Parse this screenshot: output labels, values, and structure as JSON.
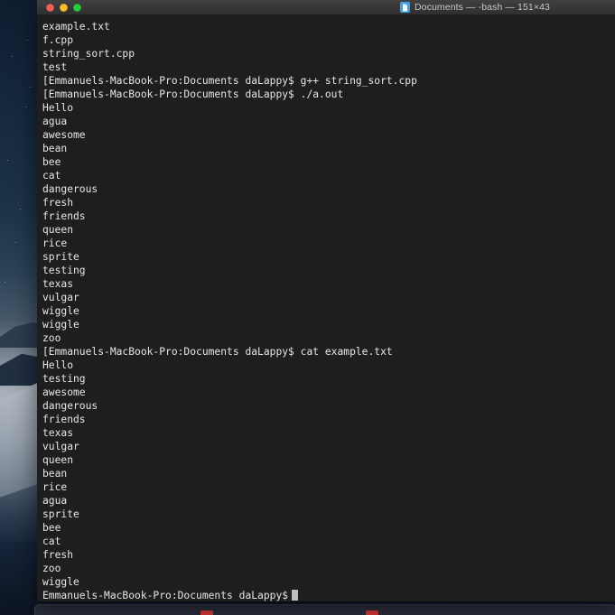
{
  "window": {
    "title": "Documents — -bash — 151×43",
    "icon": "document-icon",
    "traffic_lights": {
      "close_label": "Close",
      "minimize_label": "Minimize",
      "zoom_label": "Zoom"
    },
    "colors": {
      "terminal_background": "#1e1e1e",
      "terminal_text": "#e6e6e6",
      "titlebar": "#373737",
      "close": "#ef5f57",
      "minimize": "#f7bd2e",
      "zoom": "#2ac940",
      "doc_icon": "#3aa0e8",
      "cursor": "#bfbfbf"
    }
  },
  "terminal": {
    "prompt": "Emmanuels-MacBook-Pro:Documents daLappy$",
    "lines": [
      "example.txt",
      "f.cpp",
      "string_sort.cpp",
      "test",
      "[Emmanuels-MacBook-Pro:Documents daLappy$ g++ string_sort.cpp",
      "[Emmanuels-MacBook-Pro:Documents daLappy$ ./a.out",
      "Hello",
      "agua",
      "awesome",
      "bean",
      "bee",
      "cat",
      "dangerous",
      "fresh",
      "friends",
      "queen",
      "rice",
      "sprite",
      "testing",
      "texas",
      "vulgar",
      "wiggle",
      "wiggle",
      "zoo",
      "[Emmanuels-MacBook-Pro:Documents daLappy$ cat example.txt",
      "Hello",
      "testing",
      "awesome",
      "dangerous",
      "friends",
      "texas",
      "vulgar",
      "queen",
      "bean",
      "rice",
      "agua",
      "sprite",
      "bee",
      "cat",
      "fresh",
      "zoo",
      "wiggle"
    ],
    "final_prompt": "Emmanuels-MacBook-Pro:Documents daLappy$",
    "commands": [
      "g++ string_sort.cpp",
      "./a.out",
      "cat example.txt"
    ]
  },
  "desktop": {
    "wallpaper_name": "mojave-desert-night"
  }
}
